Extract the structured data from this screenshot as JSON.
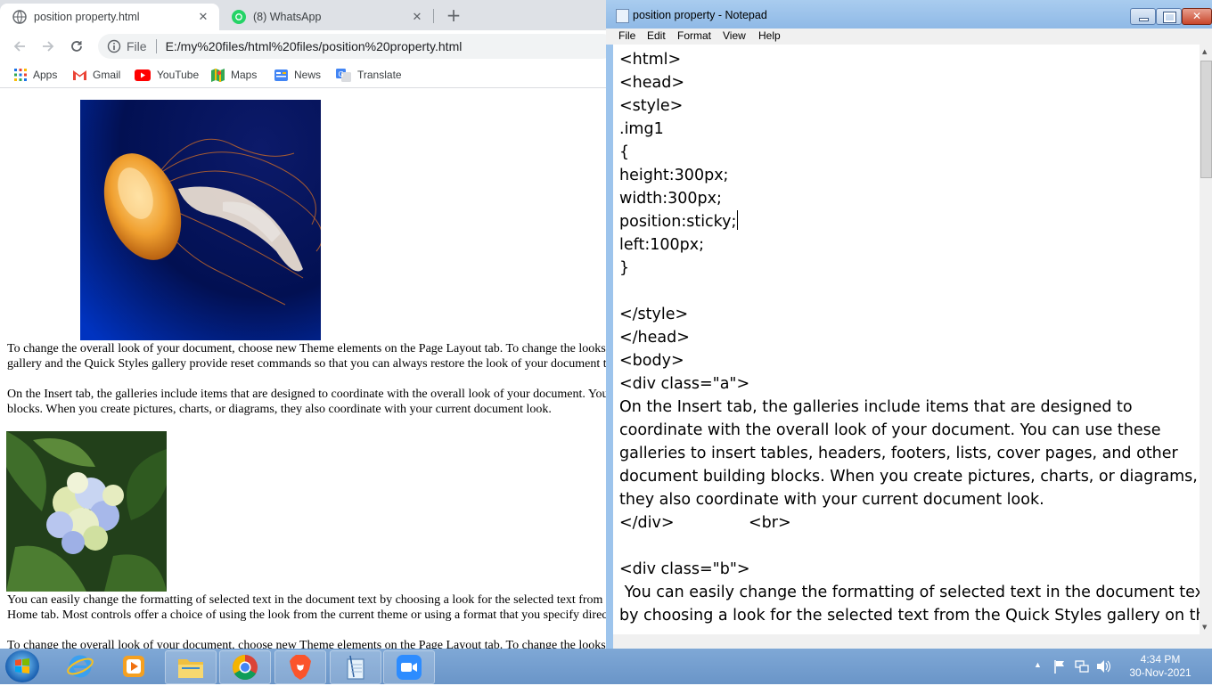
{
  "browser": {
    "tabs": [
      {
        "title": "position property.html",
        "close": "✕"
      },
      {
        "title": "(8) WhatsApp",
        "close": "✕"
      }
    ],
    "new_tab": "+",
    "address": {
      "info_label": "File",
      "url": "E:/my%20files/html%20files/position%20property.html"
    },
    "bookmarks": [
      "Apps",
      "Gmail",
      "YouTube",
      "Maps",
      "News",
      "Translate"
    ],
    "page": {
      "para1": "To change the overall look of your document, choose new Theme elements on the Page Layout tab. To change the looks available in the Quick Style gallery, use the Change Current Quick Style Set command. Both the Themes",
      "para1b": "gallery and the Quick Styles gallery provide reset commands so that you can always restore the look of your document to the original contained in your current template.",
      "para2": "On the Insert tab, the galleries include items that are designed to coordinate with the overall look of your document. You can use these galleries to insert tables, headers, footers, lists, cover pages, and other document building",
      "para2b": "blocks. When you create pictures, charts, or diagrams, they also coordinate with your current document look.",
      "para3": "You can easily change the formatting of selected text in the document text by choosing a look for the selected text from the Quick Styles gallery on the",
      "para3b": "Home tab. Most controls offer a choice of using the look from the current theme or using a format that you specify directly.",
      "para4": "To change the overall look of your document, choose new Theme elements on the Page Layout tab. To change the looks available in the Quick Style gallery, use the Change Current Quick Style Set command. Both the Themes"
    }
  },
  "notepad": {
    "title": "position property - Notepad",
    "menu": [
      "File",
      "Edit",
      "Format",
      "View",
      "Help"
    ],
    "code": "<html>\n<head>\n<style>\n.img1\n{\nheight:300px;\nwidth:300px;\nposition:sticky;\nleft:100px;\n}\n\n</style>\n</head>\n<body>\n<div class=\"a\">\nOn the Insert tab, the galleries include items that are designed to\ncoordinate with the overall look of your document. You can use these\ngalleries to insert tables, headers, footers, lists, cover pages, and other\ndocument building blocks. When you create pictures, charts, or diagrams,\nthey also coordinate with your current document look.\n</div>               <br>\n\n<div class=\"b\">\n You can easily change the formatting of selected text in the document text\nby choosing a look for the selected text from the Quick Styles gallery on the"
  },
  "taskbar": {
    "time": "4:34 PM",
    "date": "30-Nov-2021"
  }
}
